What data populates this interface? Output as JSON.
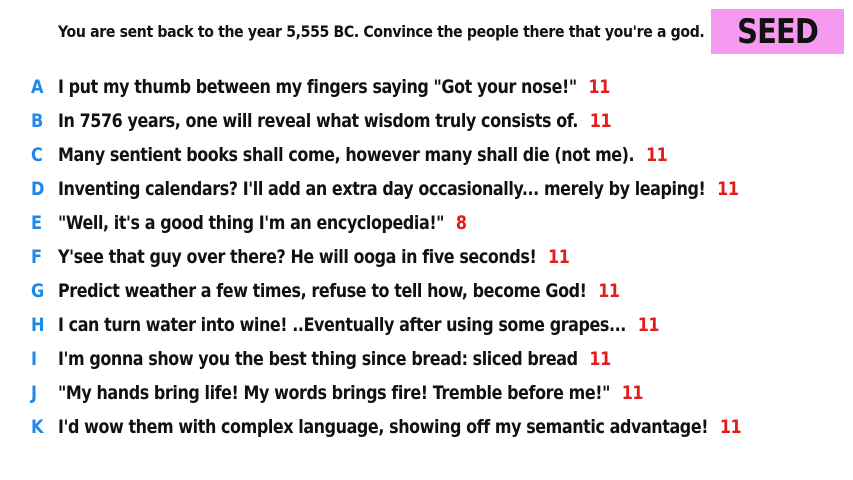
{
  "prompt": "You are sent back to the year 5,555 BC. Convince the people there that you're a god.",
  "badge": {
    "label": "SEED",
    "color": "#f59af0"
  },
  "colors": {
    "letter": "#1f88e8",
    "score": "#e31b1b"
  },
  "answers": [
    {
      "letter": "A",
      "text": "I put my thumb between my fingers saying \"Got your nose!\"",
      "score": "11"
    },
    {
      "letter": "B",
      "text": "In 7576 years, one will reveal what wisdom truly consists of.",
      "score": "11"
    },
    {
      "letter": "C",
      "text": "Many sentient books shall come, however many shall die (not me).",
      "score": "11"
    },
    {
      "letter": "D",
      "text": "Inventing calendars? I'll add an extra day occasionally... merely by leaping!",
      "score": "11"
    },
    {
      "letter": "E",
      "text": "\"Well, it's a good thing I'm an encyclopedia!\"",
      "score": "8"
    },
    {
      "letter": "F",
      "text": "Y'see that guy over there? He will ooga in five seconds!",
      "score": "11"
    },
    {
      "letter": "G",
      "text": "Predict weather a few times, refuse to tell how, become God!",
      "score": "11"
    },
    {
      "letter": "H",
      "text": "I can turn water into wine! ..Eventually after using some grapes...",
      "score": "11"
    },
    {
      "letter": "I",
      "text": "I'm gonna show you the best thing since bread: sliced bread",
      "score": "11"
    },
    {
      "letter": "J",
      "text": "\"My hands bring life! My words brings fire! Tremble before me!\"",
      "score": "11"
    },
    {
      "letter": "K",
      "text": "I'd wow them with complex language, showing off my semantic advantage!",
      "score": "11"
    }
  ]
}
